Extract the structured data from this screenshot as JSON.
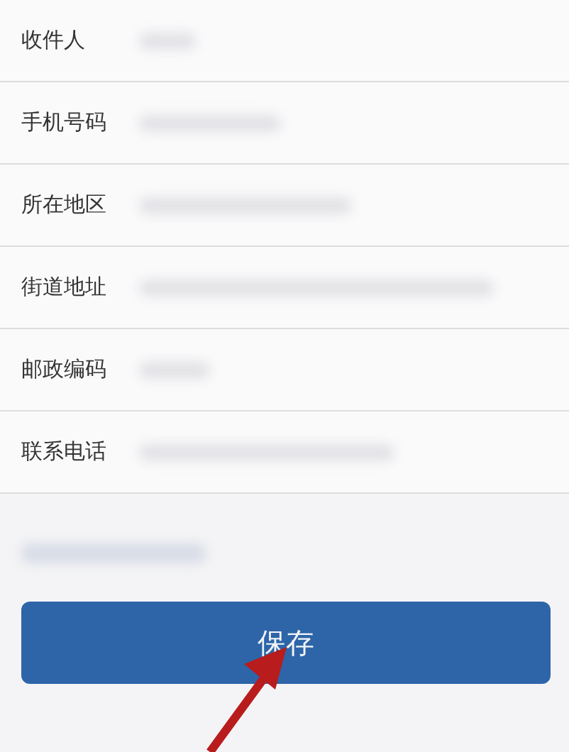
{
  "form": {
    "fields": [
      {
        "label": "收件人"
      },
      {
        "label": "手机号码"
      },
      {
        "label": "所在地区"
      },
      {
        "label": "街道地址"
      },
      {
        "label": "邮政编码"
      },
      {
        "label": "联系电话"
      }
    ]
  },
  "save_button": {
    "label": "保存"
  }
}
